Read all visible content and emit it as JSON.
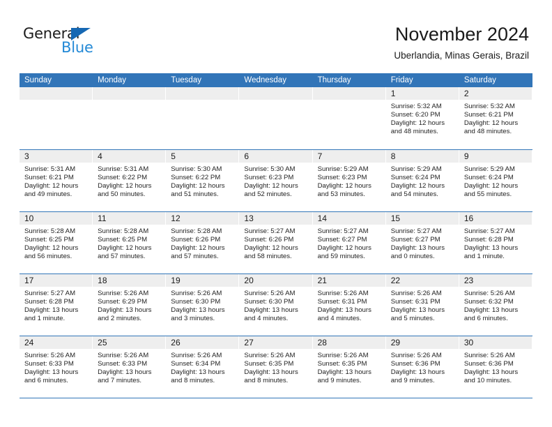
{
  "brand": {
    "name_part1": "General",
    "name_part2": "Blue",
    "triangle_color": "#1668b3",
    "blue_text_color": "#2389d6"
  },
  "header": {
    "title": "November 2024",
    "subtitle": "Uberlandia, Minas Gerais, Brazil"
  },
  "theme": {
    "header_band": "#3275b8",
    "day_band": "#eeeeee",
    "text": "#1a1a1a"
  },
  "weekdays": [
    "Sunday",
    "Monday",
    "Tuesday",
    "Wednesday",
    "Thursday",
    "Friday",
    "Saturday"
  ],
  "weeks": [
    [
      {
        "day": "",
        "sunrise": "",
        "sunset": "",
        "daylight_line1": "",
        "daylight_line2": ""
      },
      {
        "day": "",
        "sunrise": "",
        "sunset": "",
        "daylight_line1": "",
        "daylight_line2": ""
      },
      {
        "day": "",
        "sunrise": "",
        "sunset": "",
        "daylight_line1": "",
        "daylight_line2": ""
      },
      {
        "day": "",
        "sunrise": "",
        "sunset": "",
        "daylight_line1": "",
        "daylight_line2": ""
      },
      {
        "day": "",
        "sunrise": "",
        "sunset": "",
        "daylight_line1": "",
        "daylight_line2": ""
      },
      {
        "day": "1",
        "sunrise": "Sunrise: 5:32 AM",
        "sunset": "Sunset: 6:20 PM",
        "daylight_line1": "Daylight: 12 hours",
        "daylight_line2": "and 48 minutes."
      },
      {
        "day": "2",
        "sunrise": "Sunrise: 5:32 AM",
        "sunset": "Sunset: 6:21 PM",
        "daylight_line1": "Daylight: 12 hours",
        "daylight_line2": "and 48 minutes."
      }
    ],
    [
      {
        "day": "3",
        "sunrise": "Sunrise: 5:31 AM",
        "sunset": "Sunset: 6:21 PM",
        "daylight_line1": "Daylight: 12 hours",
        "daylight_line2": "and 49 minutes."
      },
      {
        "day": "4",
        "sunrise": "Sunrise: 5:31 AM",
        "sunset": "Sunset: 6:22 PM",
        "daylight_line1": "Daylight: 12 hours",
        "daylight_line2": "and 50 minutes."
      },
      {
        "day": "5",
        "sunrise": "Sunrise: 5:30 AM",
        "sunset": "Sunset: 6:22 PM",
        "daylight_line1": "Daylight: 12 hours",
        "daylight_line2": "and 51 minutes."
      },
      {
        "day": "6",
        "sunrise": "Sunrise: 5:30 AM",
        "sunset": "Sunset: 6:23 PM",
        "daylight_line1": "Daylight: 12 hours",
        "daylight_line2": "and 52 minutes."
      },
      {
        "day": "7",
        "sunrise": "Sunrise: 5:29 AM",
        "sunset": "Sunset: 6:23 PM",
        "daylight_line1": "Daylight: 12 hours",
        "daylight_line2": "and 53 minutes."
      },
      {
        "day": "8",
        "sunrise": "Sunrise: 5:29 AM",
        "sunset": "Sunset: 6:24 PM",
        "daylight_line1": "Daylight: 12 hours",
        "daylight_line2": "and 54 minutes."
      },
      {
        "day": "9",
        "sunrise": "Sunrise: 5:29 AM",
        "sunset": "Sunset: 6:24 PM",
        "daylight_line1": "Daylight: 12 hours",
        "daylight_line2": "and 55 minutes."
      }
    ],
    [
      {
        "day": "10",
        "sunrise": "Sunrise: 5:28 AM",
        "sunset": "Sunset: 6:25 PM",
        "daylight_line1": "Daylight: 12 hours",
        "daylight_line2": "and 56 minutes."
      },
      {
        "day": "11",
        "sunrise": "Sunrise: 5:28 AM",
        "sunset": "Sunset: 6:25 PM",
        "daylight_line1": "Daylight: 12 hours",
        "daylight_line2": "and 57 minutes."
      },
      {
        "day": "12",
        "sunrise": "Sunrise: 5:28 AM",
        "sunset": "Sunset: 6:26 PM",
        "daylight_line1": "Daylight: 12 hours",
        "daylight_line2": "and 57 minutes."
      },
      {
        "day": "13",
        "sunrise": "Sunrise: 5:27 AM",
        "sunset": "Sunset: 6:26 PM",
        "daylight_line1": "Daylight: 12 hours",
        "daylight_line2": "and 58 minutes."
      },
      {
        "day": "14",
        "sunrise": "Sunrise: 5:27 AM",
        "sunset": "Sunset: 6:27 PM",
        "daylight_line1": "Daylight: 12 hours",
        "daylight_line2": "and 59 minutes."
      },
      {
        "day": "15",
        "sunrise": "Sunrise: 5:27 AM",
        "sunset": "Sunset: 6:27 PM",
        "daylight_line1": "Daylight: 13 hours",
        "daylight_line2": "and 0 minutes."
      },
      {
        "day": "16",
        "sunrise": "Sunrise: 5:27 AM",
        "sunset": "Sunset: 6:28 PM",
        "daylight_line1": "Daylight: 13 hours",
        "daylight_line2": "and 1 minute."
      }
    ],
    [
      {
        "day": "17",
        "sunrise": "Sunrise: 5:27 AM",
        "sunset": "Sunset: 6:28 PM",
        "daylight_line1": "Daylight: 13 hours",
        "daylight_line2": "and 1 minute."
      },
      {
        "day": "18",
        "sunrise": "Sunrise: 5:26 AM",
        "sunset": "Sunset: 6:29 PM",
        "daylight_line1": "Daylight: 13 hours",
        "daylight_line2": "and 2 minutes."
      },
      {
        "day": "19",
        "sunrise": "Sunrise: 5:26 AM",
        "sunset": "Sunset: 6:30 PM",
        "daylight_line1": "Daylight: 13 hours",
        "daylight_line2": "and 3 minutes."
      },
      {
        "day": "20",
        "sunrise": "Sunrise: 5:26 AM",
        "sunset": "Sunset: 6:30 PM",
        "daylight_line1": "Daylight: 13 hours",
        "daylight_line2": "and 4 minutes."
      },
      {
        "day": "21",
        "sunrise": "Sunrise: 5:26 AM",
        "sunset": "Sunset: 6:31 PM",
        "daylight_line1": "Daylight: 13 hours",
        "daylight_line2": "and 4 minutes."
      },
      {
        "day": "22",
        "sunrise": "Sunrise: 5:26 AM",
        "sunset": "Sunset: 6:31 PM",
        "daylight_line1": "Daylight: 13 hours",
        "daylight_line2": "and 5 minutes."
      },
      {
        "day": "23",
        "sunrise": "Sunrise: 5:26 AM",
        "sunset": "Sunset: 6:32 PM",
        "daylight_line1": "Daylight: 13 hours",
        "daylight_line2": "and 6 minutes."
      }
    ],
    [
      {
        "day": "24",
        "sunrise": "Sunrise: 5:26 AM",
        "sunset": "Sunset: 6:33 PM",
        "daylight_line1": "Daylight: 13 hours",
        "daylight_line2": "and 6 minutes."
      },
      {
        "day": "25",
        "sunrise": "Sunrise: 5:26 AM",
        "sunset": "Sunset: 6:33 PM",
        "daylight_line1": "Daylight: 13 hours",
        "daylight_line2": "and 7 minutes."
      },
      {
        "day": "26",
        "sunrise": "Sunrise: 5:26 AM",
        "sunset": "Sunset: 6:34 PM",
        "daylight_line1": "Daylight: 13 hours",
        "daylight_line2": "and 8 minutes."
      },
      {
        "day": "27",
        "sunrise": "Sunrise: 5:26 AM",
        "sunset": "Sunset: 6:35 PM",
        "daylight_line1": "Daylight: 13 hours",
        "daylight_line2": "and 8 minutes."
      },
      {
        "day": "28",
        "sunrise": "Sunrise: 5:26 AM",
        "sunset": "Sunset: 6:35 PM",
        "daylight_line1": "Daylight: 13 hours",
        "daylight_line2": "and 9 minutes."
      },
      {
        "day": "29",
        "sunrise": "Sunrise: 5:26 AM",
        "sunset": "Sunset: 6:36 PM",
        "daylight_line1": "Daylight: 13 hours",
        "daylight_line2": "and 9 minutes."
      },
      {
        "day": "30",
        "sunrise": "Sunrise: 5:26 AM",
        "sunset": "Sunset: 6:36 PM",
        "daylight_line1": "Daylight: 13 hours",
        "daylight_line2": "and 10 minutes."
      }
    ]
  ]
}
